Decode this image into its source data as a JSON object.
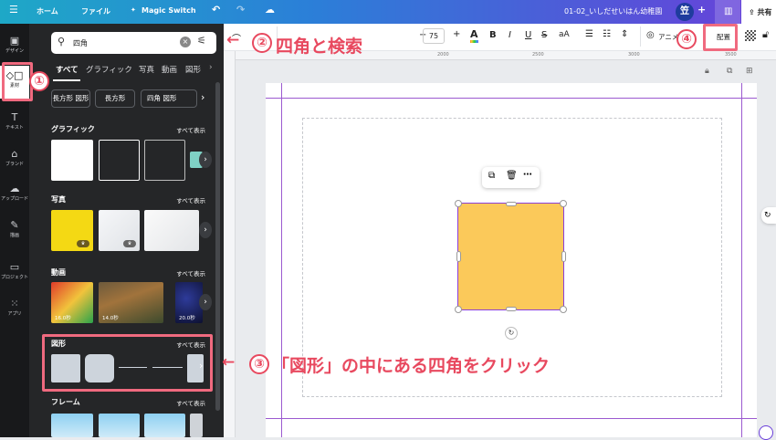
{
  "topbar": {
    "menu_icon": "hamburger-icon",
    "home": "ホーム",
    "file": "ファイル",
    "magic_switch": "Magic Switch",
    "doc_title": "01-02_いしだせいはん幼稚園",
    "avatar": "笠",
    "share": "共有"
  },
  "rail": {
    "items": [
      {
        "label": "デザイン"
      },
      {
        "label": "素材"
      },
      {
        "label": "テキスト"
      },
      {
        "label": "ブランド"
      },
      {
        "label": "アップロード"
      },
      {
        "label": "描画"
      },
      {
        "label": "プロジェクト"
      },
      {
        "label": "アプリ"
      }
    ]
  },
  "panel": {
    "search_value": "四角",
    "tabs": [
      "すべて",
      "グラフィック",
      "写真",
      "動画",
      "図形"
    ],
    "chips": [
      "長方形 図形",
      "長方形",
      "四角 図形"
    ],
    "see_all": "すべて表示",
    "sections": {
      "graphics": "グラフィック",
      "photos": "写真",
      "videos": "動画",
      "shapes": "図形",
      "frames": "フレーム"
    },
    "video_durations": [
      "16.0秒",
      "14.0秒",
      "20.0秒"
    ]
  },
  "toolbar": {
    "font_size": "75",
    "minus": "−",
    "plus": "+",
    "bold": "B",
    "italic": "I",
    "underline": "U",
    "strike": "S",
    "case": "aA",
    "animate": "アニメート",
    "arrange": "配置"
  },
  "ruler": {
    "ticks": [
      "2000",
      "2500",
      "3000",
      "3500"
    ]
  },
  "annotations": {
    "n1": "①",
    "n2": "②",
    "n2_text": "四角と検索",
    "n3": "③",
    "n3_text": "「図形」の中にある四角をクリック",
    "n4": "④",
    "arrow": "←"
  },
  "colors": {
    "accent": "#e8495f",
    "shape_fill": "#fbc95a",
    "selection": "#8b3fd9"
  }
}
